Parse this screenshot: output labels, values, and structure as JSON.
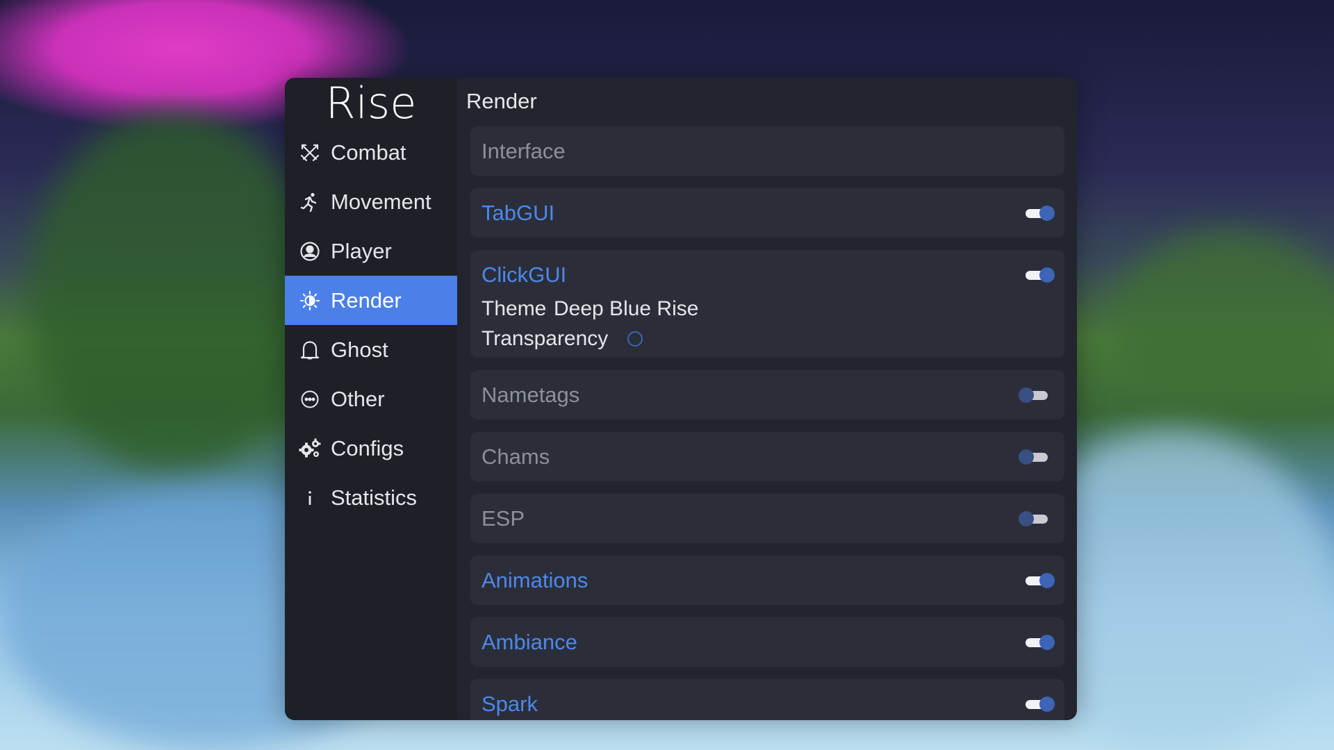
{
  "app": {
    "logo": "Rise"
  },
  "sidebar": {
    "items": [
      {
        "label": "Combat",
        "icon": "crossed-swords-icon",
        "active": false
      },
      {
        "label": "Movement",
        "icon": "running-person-icon",
        "active": false
      },
      {
        "label": "Player",
        "icon": "user-circle-icon",
        "active": false
      },
      {
        "label": "Render",
        "icon": "sun-half-icon",
        "active": true
      },
      {
        "label": "Ghost",
        "icon": "ghost-icon",
        "active": false
      },
      {
        "label": "Other",
        "icon": "dots-circle-icon",
        "active": false
      },
      {
        "label": "Configs",
        "icon": "gears-icon",
        "active": false
      },
      {
        "label": "Statistics",
        "icon": "info-icon",
        "active": false
      }
    ]
  },
  "main": {
    "title": "Render",
    "modules": {
      "interface": {
        "label": "Interface"
      },
      "tabgui": {
        "label": "TabGUI",
        "enabled": true
      },
      "clickgui": {
        "label": "ClickGUI",
        "enabled": true,
        "theme_label": "Theme",
        "theme_value": "Deep Blue Rise",
        "transparency_label": "Transparency",
        "transparency_checked": false
      },
      "nametags": {
        "label": "Nametags",
        "enabled": false
      },
      "chams": {
        "label": "Chams",
        "enabled": false
      },
      "esp": {
        "label": "ESP",
        "enabled": false
      },
      "animations": {
        "label": "Animations",
        "enabled": true
      },
      "ambiance": {
        "label": "Ambiance",
        "enabled": true
      },
      "spark": {
        "label": "Spark",
        "enabled": true
      }
    }
  },
  "colors": {
    "accent": "#4a80e8",
    "enabled_text": "#4d88ec",
    "disabled_text": "#8e9099",
    "panel_bg": "#23252e",
    "sidebar_bg": "#1e2028",
    "card_bg": "#2b2e39"
  }
}
